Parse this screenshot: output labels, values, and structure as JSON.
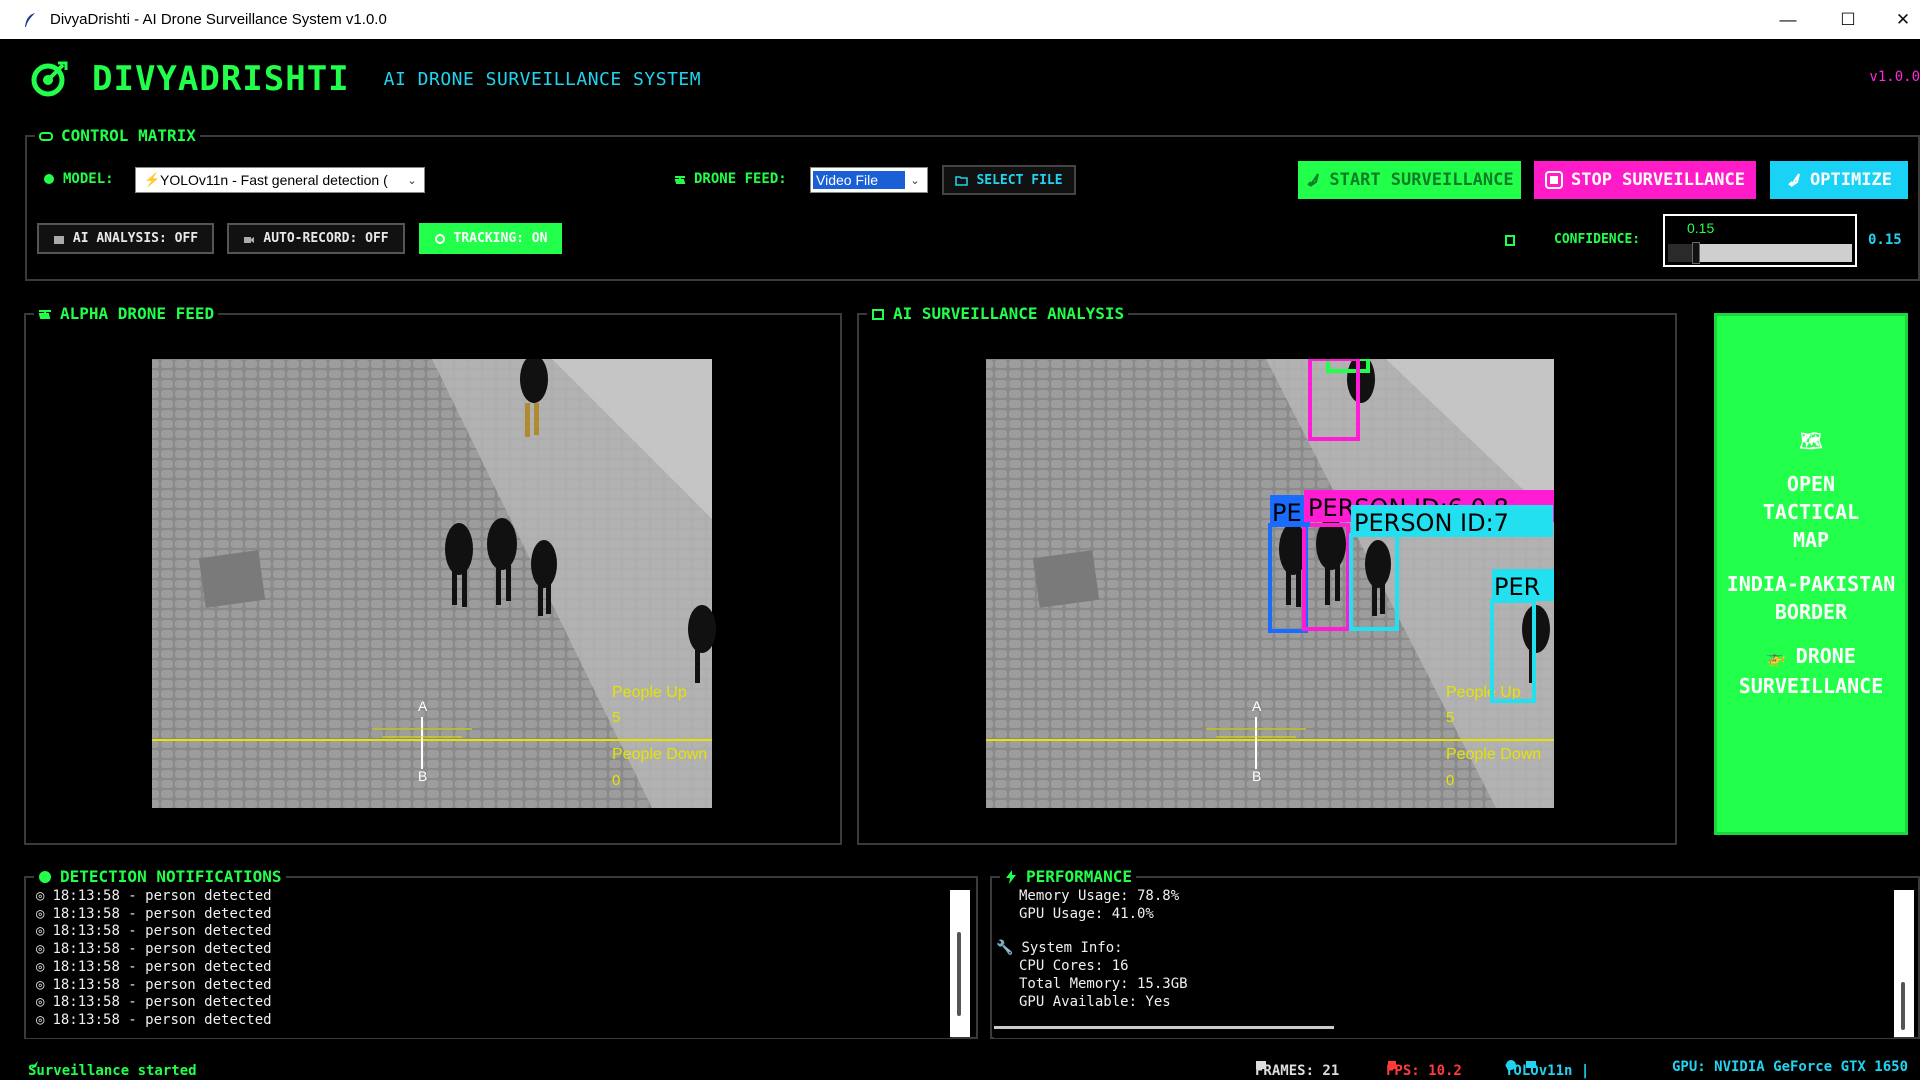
{
  "window": {
    "title": "DivyaDrishti - AI Drone Surveillance System v1.0.0",
    "minimize_glyph": "—",
    "maximize_glyph": "☐",
    "close_glyph": "✕"
  },
  "header": {
    "brand": "DIVYADRISHTI",
    "subtitle": "AI DRONE SURVEILLANCE SYSTEM",
    "version": "v1.0.0",
    "logo_icon": "target-icon"
  },
  "control_matrix": {
    "title": "CONTROL MATRIX",
    "model_label": "MODEL:",
    "model_value": "YOLOv11n - Fast general detection (",
    "drone_feed_label": "DRONE FEED:",
    "drone_feed_value": "Video File",
    "select_file": "SELECT FILE",
    "start": "START SURVEILLANCE",
    "stop": "STOP SURVEILLANCE",
    "optimize": "OPTIMIZE",
    "ai_analysis": "AI ANALYSIS: OFF",
    "auto_record": "AUTO-RECORD: OFF",
    "tracking": "TRACKING: ON",
    "confidence_label": "CONFIDENCE:",
    "confidence_value": "0.15",
    "confidence_readout": "0.15",
    "confidence_level": 0.15
  },
  "alpha_feed": {
    "title": "ALPHA DRONE FEED",
    "people_up_label": "People Up",
    "people_up_value": "5",
    "people_down_label": "People Down",
    "people_down_value": "0",
    "marker_a": "A",
    "marker_b": "B"
  },
  "ai_analysis": {
    "title": "AI SURVEILLANCE ANALYSIS",
    "people_up_label": "People Up",
    "people_up_value": "5",
    "people_down_label": "People Down",
    "people_down_value": "0",
    "marker_a": "A",
    "marker_b": "B",
    "box_labels": [
      "PE",
      "PERSON ID:6 0.8",
      "PERSON ID:7",
      "PER"
    ],
    "box_colors": [
      "#1a6cff",
      "#ff1cd4",
      "#22e0f0",
      "#22e0f0",
      "#22ff4a"
    ]
  },
  "tactical": {
    "line1": "OPEN",
    "line2": "TACTICAL",
    "line3": "MAP",
    "line4": "INDIA-PAKISTAN",
    "line5": "BORDER",
    "line6": "DRONE",
    "line7": "SURVEILLANCE"
  },
  "notifications": {
    "title": "DETECTION NOTIFICATIONS",
    "items": [
      "18:13:58 - person detected",
      "18:13:58 - person detected",
      "18:13:58 - person detected",
      "18:13:58 - person detected",
      "18:13:58 - person detected",
      "18:13:58 - person detected",
      "18:13:58 - person detected",
      "18:13:58 - person detected"
    ]
  },
  "performance": {
    "title": "PERFORMANCE",
    "memory": "Memory Usage: 78.8%",
    "gpu": "GPU Usage: 41.0%",
    "sysinfo": "System Info:",
    "cpu": "CPU Cores: 16",
    "total_mem": "Total Memory: 15.3GB",
    "gpu_avail": "GPU Available: Yes"
  },
  "status": {
    "message": "Surveillance started",
    "frames": "FRAMES: 21",
    "fps": "FPS: 10.2",
    "model": "YOLOv11n |",
    "gpu": "GPU: NVIDIA GeForce GTX 1650"
  },
  "colors": {
    "accent_green": "#22ff4a",
    "accent_cyan": "#22d3f0",
    "accent_magenta": "#ff1cc8",
    "fps_red": "#ff3b3b"
  }
}
